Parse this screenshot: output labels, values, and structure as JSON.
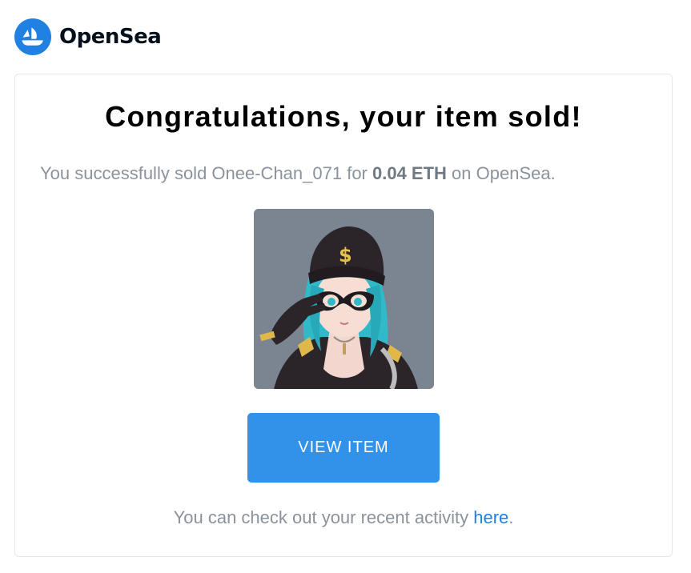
{
  "header": {
    "logo_icon": "opensea-ship-logo-icon",
    "brand_name": "OpenSea",
    "brand_color": "#2081e2"
  },
  "email": {
    "title": "Congratulations, your item sold!",
    "message_prefix": "You successfully sold Onee-Chan_071 for ",
    "message_amount": "0.04 ETH",
    "message_suffix": " on OpenSea.",
    "item_image": "anime-girl-nft-image",
    "view_button_label": "VIEW ITEM",
    "button_color": "#3291e9",
    "footer_prefix": "You can check out your recent activity ",
    "footer_link": "here",
    "footer_suffix": "."
  }
}
